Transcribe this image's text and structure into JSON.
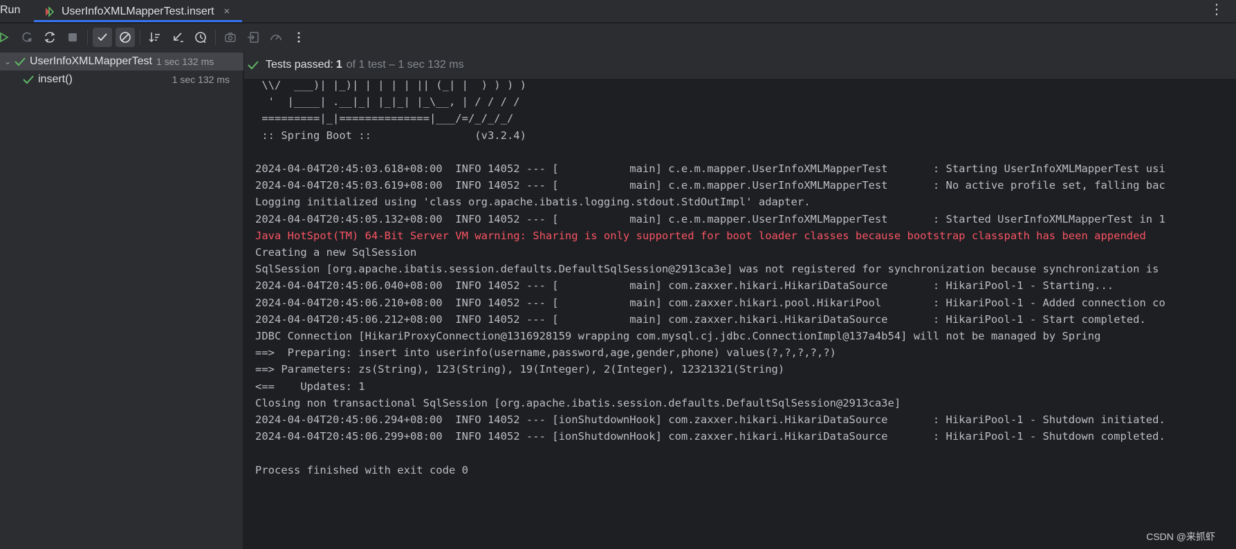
{
  "tabbar": {
    "run_label": "Run",
    "tab_title": "UserInfoXMLMapperTest.insert",
    "close_glyph": "×",
    "menu_glyph": "⋮"
  },
  "toolbar": {
    "icons": [
      "rerun-icon",
      "rerun-failed-icon",
      "toggle-auto-test-icon",
      "stop-icon",
      "show-passed-icon",
      "show-ignored-icon",
      "sort-icon",
      "collapse-icon",
      "history-icon",
      "screenshot-icon",
      "import-tests-icon",
      "coverage-icon",
      "more-icon"
    ]
  },
  "tree": {
    "root": {
      "name": "UserInfoXMLMapperTest",
      "time": "1 sec 132 ms"
    },
    "child": {
      "name": "insert()",
      "time": "1 sec 132 ms"
    }
  },
  "status": {
    "prefix": "Tests passed:",
    "count": "1",
    "suffix": "of 1 test – 1 sec 132 ms"
  },
  "console": {
    "lines": [
      {
        "text": " \\\\/  ___)| |_)| | | | | || (_| |  ) ) ) )",
        "kind": "normal"
      },
      {
        "text": "  '  |____| .__|_| |_|_| |_\\__, | / / / /",
        "kind": "normal"
      },
      {
        "text": " =========|_|==============|___/=/_/_/_/",
        "kind": "normal"
      },
      {
        "text": " :: Spring Boot ::                (v3.2.4)",
        "kind": "normal"
      },
      {
        "text": "",
        "kind": "normal"
      },
      {
        "text": "2024-04-04T20:45:03.618+08:00  INFO 14052 --- [           main] c.e.m.mapper.UserInfoXMLMapperTest       : Starting UserInfoXMLMapperTest usi",
        "kind": "normal"
      },
      {
        "text": "2024-04-04T20:45:03.619+08:00  INFO 14052 --- [           main] c.e.m.mapper.UserInfoXMLMapperTest       : No active profile set, falling bac",
        "kind": "normal"
      },
      {
        "text": "Logging initialized using 'class org.apache.ibatis.logging.stdout.StdOutImpl' adapter.",
        "kind": "normal"
      },
      {
        "text": "2024-04-04T20:45:05.132+08:00  INFO 14052 --- [           main] c.e.m.mapper.UserInfoXMLMapperTest       : Started UserInfoXMLMapperTest in 1",
        "kind": "normal"
      },
      {
        "text": "Java HotSpot(TM) 64-Bit Server VM warning: Sharing is only supported for boot loader classes because bootstrap classpath has been appended",
        "kind": "err"
      },
      {
        "text": "Creating a new SqlSession",
        "kind": "normal"
      },
      {
        "text": "SqlSession [org.apache.ibatis.session.defaults.DefaultSqlSession@2913ca3e] was not registered for synchronization because synchronization is",
        "kind": "normal"
      },
      {
        "text": "2024-04-04T20:45:06.040+08:00  INFO 14052 --- [           main] com.zaxxer.hikari.HikariDataSource       : HikariPool-1 - Starting...",
        "kind": "normal"
      },
      {
        "text": "2024-04-04T20:45:06.210+08:00  INFO 14052 --- [           main] com.zaxxer.hikari.pool.HikariPool        : HikariPool-1 - Added connection co",
        "kind": "normal"
      },
      {
        "text": "2024-04-04T20:45:06.212+08:00  INFO 14052 --- [           main] com.zaxxer.hikari.HikariDataSource       : HikariPool-1 - Start completed.",
        "kind": "normal"
      },
      {
        "text": "JDBC Connection [HikariProxyConnection@1316928159 wrapping com.mysql.cj.jdbc.ConnectionImpl@137a4b54] will not be managed by Spring",
        "kind": "normal"
      },
      {
        "text": "==>  Preparing: insert into userinfo(username,password,age,gender,phone) values(?,?,?,?,?)",
        "kind": "normal"
      },
      {
        "text": "==> Parameters: zs(String), 123(String), 19(Integer), 2(Integer), 12321321(String)",
        "kind": "normal"
      },
      {
        "text": "<==    Updates: 1",
        "kind": "normal"
      },
      {
        "text": "Closing non transactional SqlSession [org.apache.ibatis.session.defaults.DefaultSqlSession@2913ca3e]",
        "kind": "normal"
      },
      {
        "text": "2024-04-04T20:45:06.294+08:00  INFO 14052 --- [ionShutdownHook] com.zaxxer.hikari.HikariDataSource       : HikariPool-1 - Shutdown initiated.",
        "kind": "normal"
      },
      {
        "text": "2024-04-04T20:45:06.299+08:00  INFO 14052 --- [ionShutdownHook] com.zaxxer.hikari.HikariDataSource       : HikariPool-1 - Shutdown completed.",
        "kind": "normal"
      },
      {
        "text": "",
        "kind": "normal"
      },
      {
        "text": "Process finished with exit code 0",
        "kind": "normal"
      }
    ]
  },
  "watermark": "CSDN @来抓虾",
  "colors": {
    "pass_green": "#5fb865",
    "error_red": "#f75464",
    "accent_blue": "#3574f0"
  }
}
